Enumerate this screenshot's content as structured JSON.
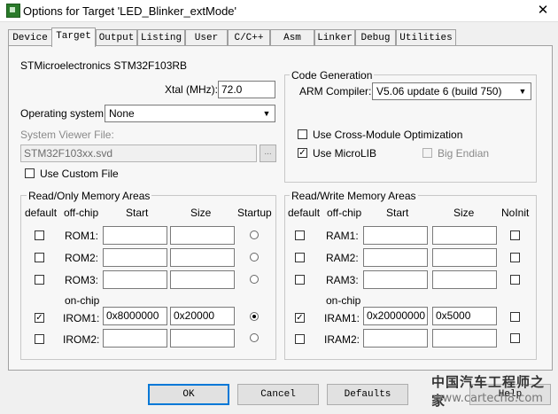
{
  "window": {
    "title": "Options for Target 'LED_Blinker_extMode'",
    "close_glyph": "✕"
  },
  "tabs": [
    "Device",
    "Target",
    "Output",
    "Listing",
    "User",
    "C/C++",
    "Asm",
    "Linker",
    "Debug",
    "Utilities"
  ],
  "active_tab": "Target",
  "device": {
    "name": "STMicroelectronics STM32F103RB"
  },
  "xtal": {
    "label": "Xtal (MHz):",
    "value": "72.0"
  },
  "os": {
    "label": "Operating system:",
    "value": "None"
  },
  "svd": {
    "label": "System Viewer File:",
    "value": "STM32F103xx.svd",
    "browse": "...",
    "custom_label": "Use Custom File",
    "custom_checked": false
  },
  "codegen": {
    "title": "Code Generation",
    "compiler_label": "ARM Compiler:",
    "compiler_value": "V5.06 update 6 (build 750)",
    "cross_module_label": "Use Cross-Module Optimization",
    "microlib_label": "Use MicroLIB",
    "big_endian_label": "Big Endian"
  },
  "rom": {
    "title": "Read/Only Memory Areas",
    "headers": {
      "default": "default",
      "offchip": "off-chip",
      "start": "Start",
      "size": "Size",
      "startup": "Startup"
    },
    "onchip_label": "on-chip",
    "rows": [
      {
        "label": "ROM1:",
        "start": "",
        "size": "",
        "default": false,
        "startup": false
      },
      {
        "label": "ROM2:",
        "start": "",
        "size": "",
        "default": false,
        "startup": false
      },
      {
        "label": "ROM3:",
        "start": "",
        "size": "",
        "default": false,
        "startup": false
      },
      {
        "label": "IROM1:",
        "start": "0x8000000",
        "size": "0x20000",
        "default": true,
        "startup": true
      },
      {
        "label": "IROM2:",
        "start": "",
        "size": "",
        "default": false,
        "startup": false
      }
    ]
  },
  "ram": {
    "title": "Read/Write Memory Areas",
    "headers": {
      "default": "default",
      "offchip": "off-chip",
      "start": "Start",
      "size": "Size",
      "noinit": "NoInit"
    },
    "onchip_label": "on-chip",
    "rows": [
      {
        "label": "RAM1:",
        "start": "",
        "size": "",
        "default": false
      },
      {
        "label": "RAM2:",
        "start": "",
        "size": "",
        "default": false
      },
      {
        "label": "RAM3:",
        "start": "",
        "size": "",
        "default": false
      },
      {
        "label": "IRAM1:",
        "start": "0x20000000",
        "size": "0x5000",
        "default": true
      },
      {
        "label": "IRAM2:",
        "start": "",
        "size": "",
        "default": false
      }
    ]
  },
  "buttons": {
    "ok": "OK",
    "cancel": "Cancel",
    "defaults": "Defaults",
    "help": "Help"
  },
  "watermark": {
    "line1": "中国汽车工程师之家",
    "line2": "www.cartech8.com"
  },
  "colors": {
    "focus_border": "#0078d7",
    "panel_bg": "#f7f7f7",
    "window_bg": "#f0f0f0"
  }
}
